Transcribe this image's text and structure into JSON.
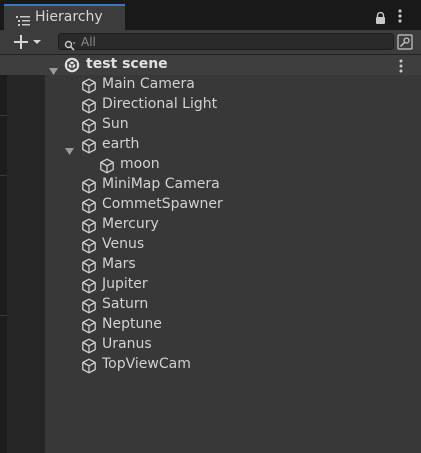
{
  "tab": {
    "title": "Hierarchy",
    "icon": "hierarchy-list-icon"
  },
  "toolbar": {
    "add_icon": "plus-icon",
    "dropdown_icon": "chevron-down-icon",
    "search_placeholder": "All",
    "search_icon": "search-icon"
  },
  "scene": {
    "name": "test scene",
    "expanded": true,
    "icon": "unity-scene-icon"
  },
  "objects": [
    {
      "label": "Main Camera",
      "depth": 0,
      "icon": "cube-icon"
    },
    {
      "label": "Directional Light",
      "depth": 0,
      "icon": "cube-icon"
    },
    {
      "label": "Sun",
      "depth": 0,
      "icon": "cube-icon"
    },
    {
      "label": "earth",
      "depth": 0,
      "expanded": true,
      "icon": "cube-icon"
    },
    {
      "label": "moon",
      "depth": 1,
      "icon": "cube-icon"
    },
    {
      "label": "MiniMap Camera",
      "depth": 0,
      "icon": "cube-icon"
    },
    {
      "label": "CommetSpawner",
      "depth": 0,
      "icon": "cube-icon"
    },
    {
      "label": "Mercury",
      "depth": 0,
      "icon": "cube-icon"
    },
    {
      "label": "Venus",
      "depth": 0,
      "icon": "cube-icon"
    },
    {
      "label": "Mars",
      "depth": 0,
      "icon": "cube-icon"
    },
    {
      "label": "Jupiter",
      "depth": 0,
      "icon": "cube-icon"
    },
    {
      "label": "Saturn",
      "depth": 0,
      "icon": "cube-icon"
    },
    {
      "label": "Neptune",
      "depth": 0,
      "icon": "cube-icon"
    },
    {
      "label": "Uranus",
      "depth": 0,
      "icon": "cube-icon"
    },
    {
      "label": "TopViewCam",
      "depth": 0,
      "icon": "cube-icon"
    }
  ]
}
